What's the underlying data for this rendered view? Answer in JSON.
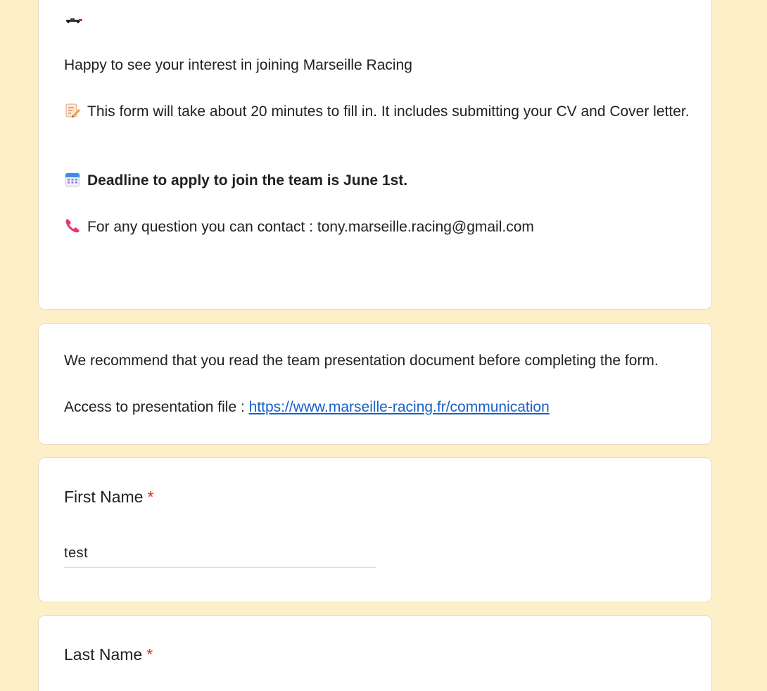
{
  "intro": {
    "car_icon": "racing-car-icon",
    "welcome_text": "Happy to see your interest in joining Marseille Racing",
    "duration_icon": "memo-pencil-icon",
    "duration_text": "This form will take about 20 minutes to fill in. It includes submitting your CV and Cover letter.",
    "deadline_icon": "calendar-icon",
    "deadline_text": "Deadline to apply to join the team is June 1st.",
    "contact_icon": "telephone-receiver-icon",
    "contact_text": "For any question you can contact : tony.marseille.racing@gmail.com"
  },
  "recommendation": {
    "text": "We recommend that you read the team presentation document before completing the form.",
    "access_label": "Access to presentation file : ",
    "link_text": "https://www.marseille-racing.fr/communication"
  },
  "questions": {
    "first_name": {
      "label": "First Name",
      "required_mark": "*",
      "value": "test"
    },
    "last_name": {
      "label": "Last Name",
      "required_mark": "*"
    }
  },
  "colors": {
    "page_background": "#fdf0c8",
    "link": "#1a5fc8",
    "required": "#d93025"
  }
}
